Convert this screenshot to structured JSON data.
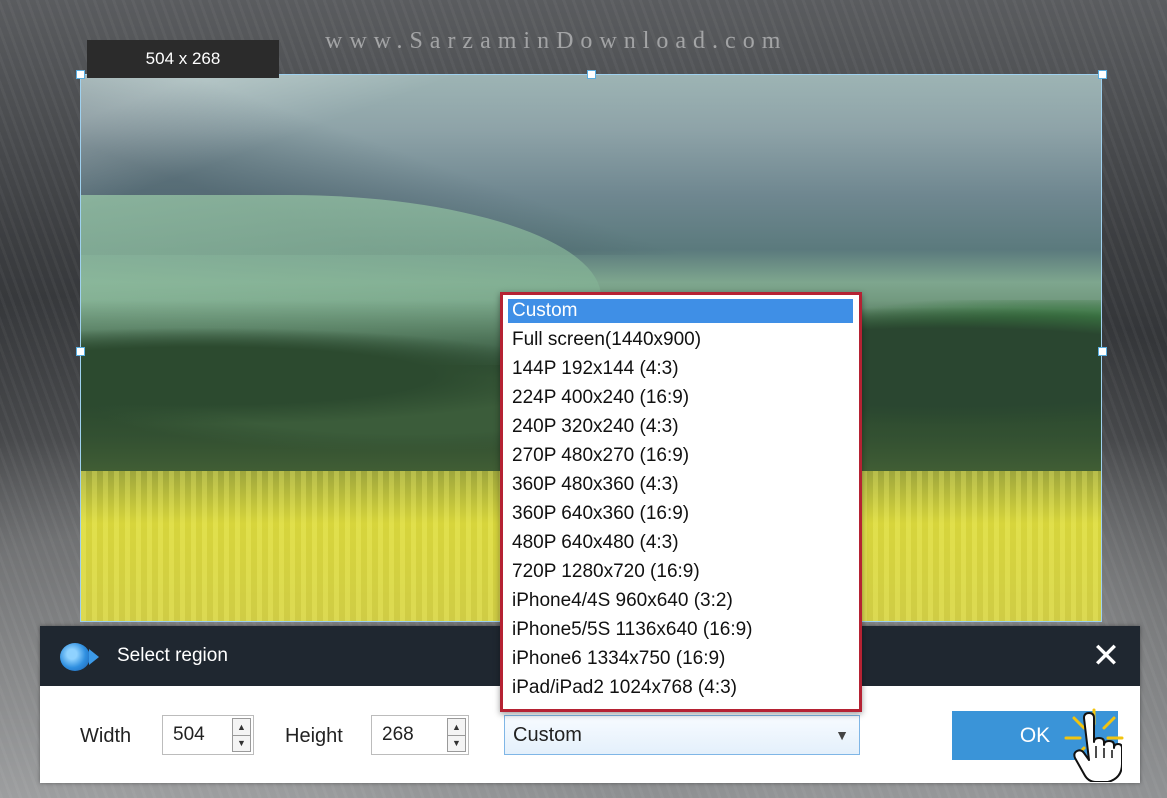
{
  "watermark": "www.SarzaminDownload.com",
  "size_label": "504 x 268",
  "dialog": {
    "title": "Select region",
    "close_glyph": "✕",
    "width_label": "Width",
    "width_value": "504",
    "height_label": "Height",
    "height_value": "268",
    "preset_selected": "Custom",
    "ok_label": "OK"
  },
  "dropdown": {
    "options": [
      "Custom",
      "Full screen(1440x900)",
      "144P 192x144 (4:3)",
      "224P 400x240 (16:9)",
      "240P 320x240 (4:3)",
      "270P 480x270 (16:9)",
      "360P 480x360 (4:3)",
      "360P 640x360 (16:9)",
      "480P 640x480 (4:3)",
      "720P 1280x720 (16:9)",
      "iPhone4/4S 960x640 (3:2)",
      "iPhone5/5S 1136x640 (16:9)",
      "iPhone6 1334x750 (16:9)",
      "iPad/iPad2 1024x768 (4:3)"
    ],
    "highlighted": "Custom"
  },
  "icons": {
    "app": "video-camera-icon",
    "close": "close-icon",
    "dropdown": "chevron-down-icon",
    "spin_up": "arrow-up-icon",
    "spin_down": "arrow-down-icon",
    "cursor": "hand-pointer-icon"
  },
  "colors": {
    "titlebar": "#1f2730",
    "ok_button": "#3a94d8",
    "selection_highlight": "#3f8fe6",
    "dropdown_border": "#b52233",
    "region_border": "#9fd1ef"
  }
}
